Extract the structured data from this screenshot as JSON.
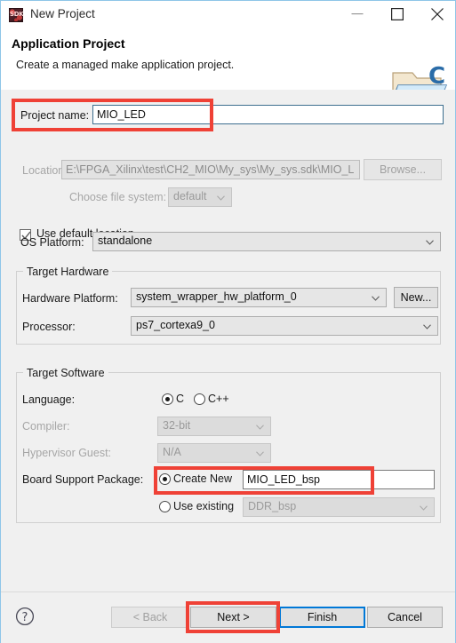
{
  "window": {
    "title": "New Project",
    "app_icon": "sdk-icon",
    "icon_text": "SDK",
    "controls": {
      "minimize": "minimize-icon",
      "maximize": "maximize-icon",
      "close": "close-icon"
    }
  },
  "header": {
    "title": "Application Project",
    "subtitle": "Create a managed make application project.",
    "icon": "folder-c-icon"
  },
  "project": {
    "name_label": "Project name:",
    "name_value": "MIO_LED",
    "use_default_location_label": "Use default location",
    "use_default_location_checked": true,
    "location_label": "Location:",
    "location_value": "E:\\FPGA_Xilinx\\test\\CH2_MIO\\My_sys\\My_sys.sdk\\MIO_L",
    "browse_label": "Browse...",
    "file_system_label": "Choose file system:",
    "file_system_value": "default"
  },
  "os_platform": {
    "label": "OS Platform:",
    "value": "standalone"
  },
  "target_hardware": {
    "group_title": "Target Hardware",
    "hardware_platform_label": "Hardware Platform:",
    "hardware_platform_value": "system_wrapper_hw_platform_0",
    "new_button_label": "New...",
    "processor_label": "Processor:",
    "processor_value": "ps7_cortexa9_0"
  },
  "target_software": {
    "group_title": "Target Software",
    "language_label": "Language:",
    "language_options": [
      "C",
      "C++"
    ],
    "language_selected": "C",
    "compiler_label": "Compiler:",
    "compiler_value": "32-bit",
    "hypervisor_label": "Hypervisor Guest:",
    "hypervisor_value": "N/A",
    "bsp_label": "Board Support Package:",
    "bsp_create_new_label": "Create New",
    "bsp_create_new_value": "MIO_LED_bsp",
    "bsp_use_existing_label": "Use existing",
    "bsp_use_existing_value": "DDR_bsp",
    "bsp_selected": "Create New"
  },
  "footer": {
    "help_icon": "help-icon",
    "back_label": "< Back",
    "next_label": "Next >",
    "finish_label": "Finish",
    "cancel_label": "Cancel",
    "back_enabled": false,
    "default_button": "Finish"
  },
  "annotations": {
    "color": "#ef4136",
    "boxes": [
      "project-name-row",
      "bsp-create-new-row",
      "next-button"
    ]
  }
}
